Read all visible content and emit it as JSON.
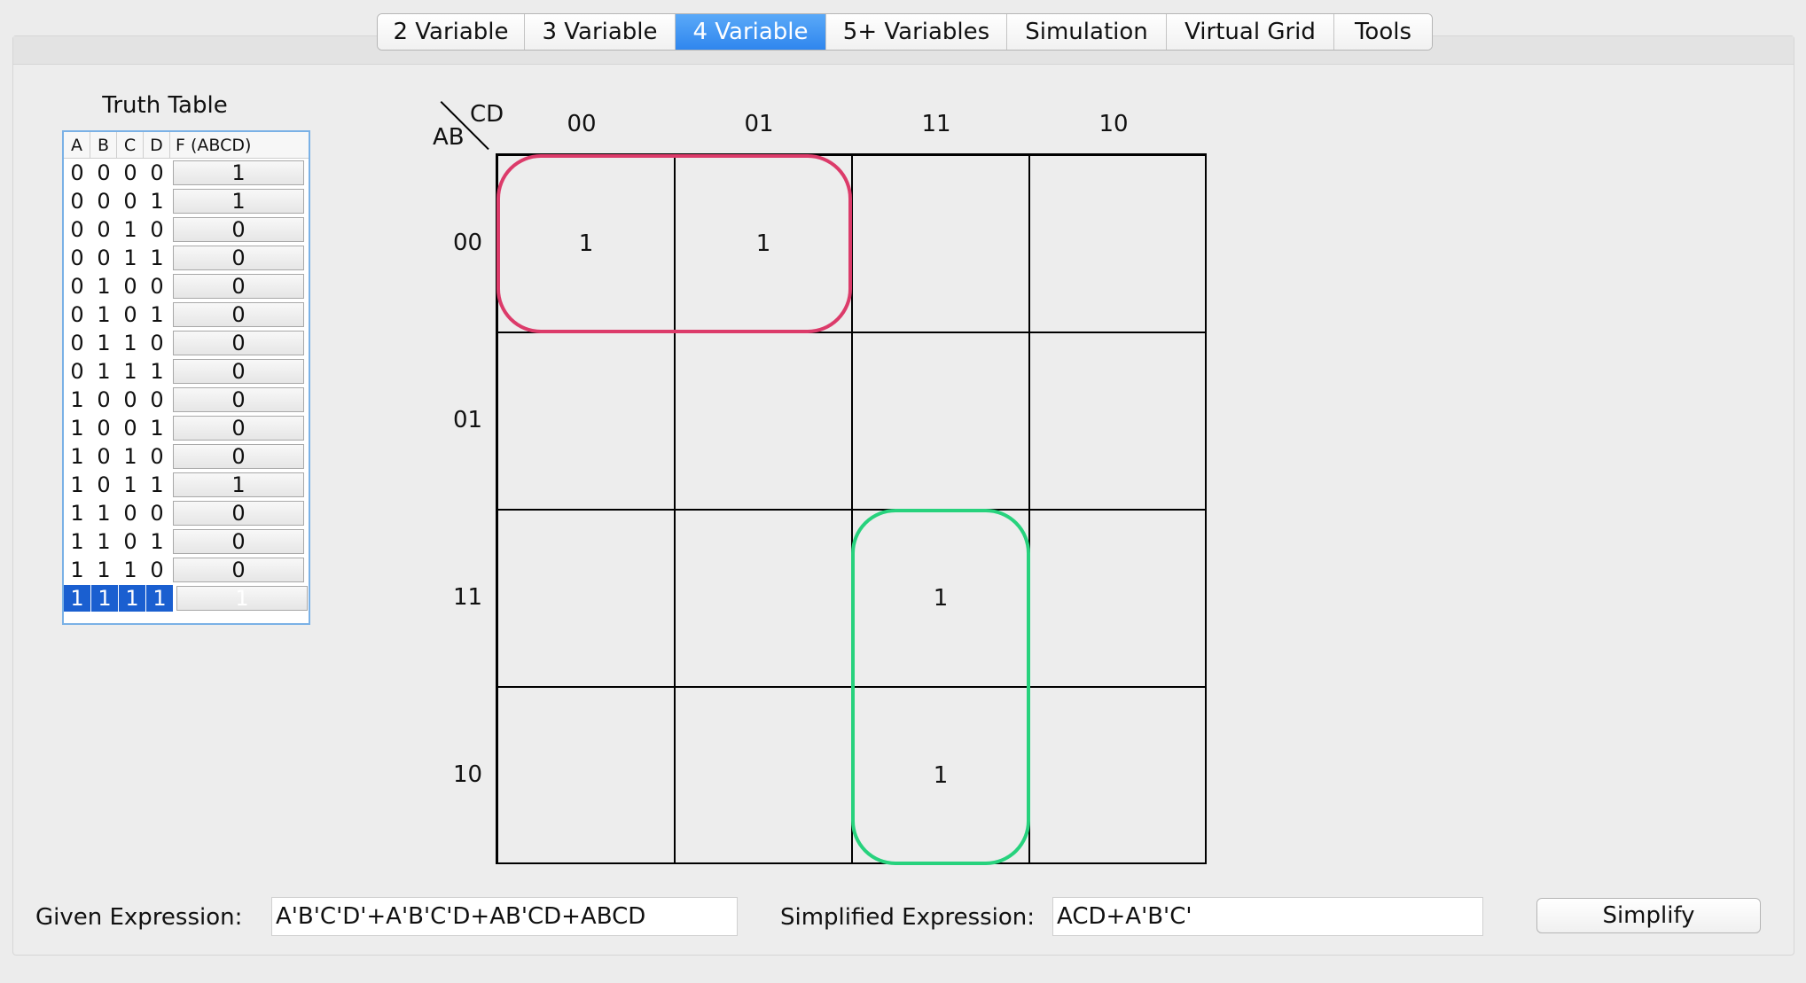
{
  "tabs": [
    {
      "label": "2 Variable",
      "active": false
    },
    {
      "label": "3 Variable",
      "active": false
    },
    {
      "label": "4 Variable",
      "active": true
    },
    {
      "label": "5+ Variables",
      "active": false
    },
    {
      "label": "Simulation",
      "active": false
    },
    {
      "label": "Virtual Grid",
      "active": false
    },
    {
      "label": "Tools",
      "active": false
    }
  ],
  "truth_table": {
    "title": "Truth Table",
    "headers": [
      "A",
      "B",
      "C",
      "D",
      "F (ABCD)"
    ],
    "rows": [
      {
        "inputs": [
          "0",
          "0",
          "0",
          "0"
        ],
        "f": "1"
      },
      {
        "inputs": [
          "0",
          "0",
          "0",
          "1"
        ],
        "f": "1"
      },
      {
        "inputs": [
          "0",
          "0",
          "1",
          "0"
        ],
        "f": "0"
      },
      {
        "inputs": [
          "0",
          "0",
          "1",
          "1"
        ],
        "f": "0"
      },
      {
        "inputs": [
          "0",
          "1",
          "0",
          "0"
        ],
        "f": "0"
      },
      {
        "inputs": [
          "0",
          "1",
          "0",
          "1"
        ],
        "f": "0"
      },
      {
        "inputs": [
          "0",
          "1",
          "1",
          "0"
        ],
        "f": "0"
      },
      {
        "inputs": [
          "0",
          "1",
          "1",
          "1"
        ],
        "f": "0"
      },
      {
        "inputs": [
          "1",
          "0",
          "0",
          "0"
        ],
        "f": "0"
      },
      {
        "inputs": [
          "1",
          "0",
          "0",
          "1"
        ],
        "f": "0"
      },
      {
        "inputs": [
          "1",
          "0",
          "1",
          "0"
        ],
        "f": "0"
      },
      {
        "inputs": [
          "1",
          "0",
          "1",
          "1"
        ],
        "f": "1"
      },
      {
        "inputs": [
          "1",
          "1",
          "0",
          "0"
        ],
        "f": "0"
      },
      {
        "inputs": [
          "1",
          "1",
          "0",
          "1"
        ],
        "f": "0"
      },
      {
        "inputs": [
          "1",
          "1",
          "1",
          "0"
        ],
        "f": "0"
      },
      {
        "inputs": [
          "1",
          "1",
          "1",
          "1"
        ],
        "f": "1",
        "selected": true
      }
    ]
  },
  "kmap": {
    "row_var": "AB",
    "col_var": "CD",
    "col_labels": [
      "00",
      "01",
      "11",
      "10"
    ],
    "row_labels": [
      "00",
      "01",
      "11",
      "10"
    ],
    "cells": [
      [
        "1",
        "1",
        "",
        ""
      ],
      [
        "",
        "",
        "",
        ""
      ],
      [
        "",
        "",
        "1",
        ""
      ],
      [
        "",
        "",
        "1",
        ""
      ]
    ],
    "group_colors": {
      "red": "#dc3b6a",
      "green": "#27d27d"
    }
  },
  "bottom": {
    "given_label": "Given Expression:",
    "given_value": "A'B'C'D'+A'B'C'D+AB'CD+ABCD",
    "simplified_label": "Simplified Expression:",
    "simplified_value": "ACD+A'B'C'",
    "simplify_button": "Simplify"
  },
  "colors": {
    "accent": "#2f86ee",
    "selection": "#1a5fd0"
  }
}
